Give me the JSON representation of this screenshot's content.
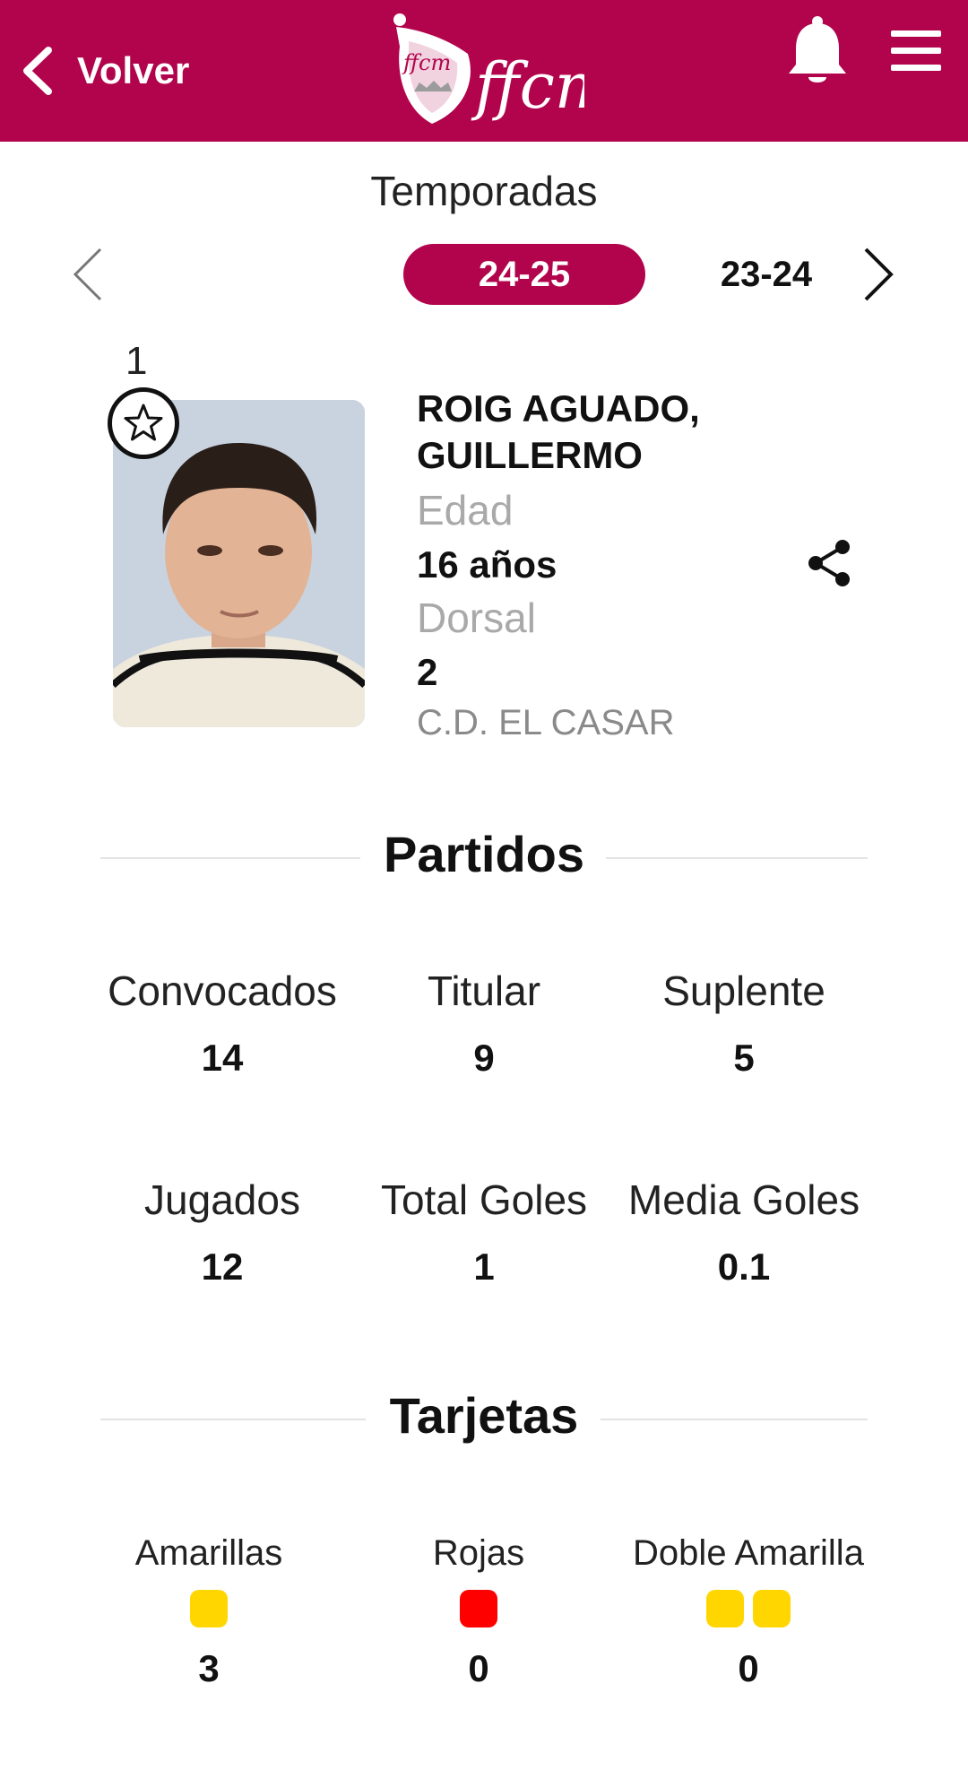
{
  "header": {
    "back_label": "Volver",
    "logo_text": "ffcm",
    "brand_color": "#b2044c"
  },
  "seasons": {
    "title": "Temporadas",
    "active": "24-25",
    "other": "23-24"
  },
  "player": {
    "rank": "1",
    "name": "ROIG AGUADO, GUILLERMO",
    "age_label": "Edad",
    "age_value": "16 años",
    "dorsal_label": "Dorsal",
    "dorsal_value": "2",
    "club": "C.D. EL CASAR"
  },
  "partidos": {
    "title": "Partidos",
    "stats": [
      {
        "label": "Convocados",
        "value": "14"
      },
      {
        "label": "Titular",
        "value": "9"
      },
      {
        "label": "Suplente",
        "value": "5"
      },
      {
        "label": "Jugados",
        "value": "12"
      },
      {
        "label": "Total Goles",
        "value": "1"
      },
      {
        "label": "Media Goles",
        "value": "0.1"
      }
    ]
  },
  "tarjetas": {
    "title": "Tarjetas",
    "items": [
      {
        "label": "Amarillas",
        "value": "3",
        "card_color": "#ffd600"
      },
      {
        "label": "Rojas",
        "value": "0",
        "card_color": "#ff0000"
      },
      {
        "label": "Doble Amarilla",
        "value": "0",
        "card_color": "#ffd600"
      }
    ]
  }
}
